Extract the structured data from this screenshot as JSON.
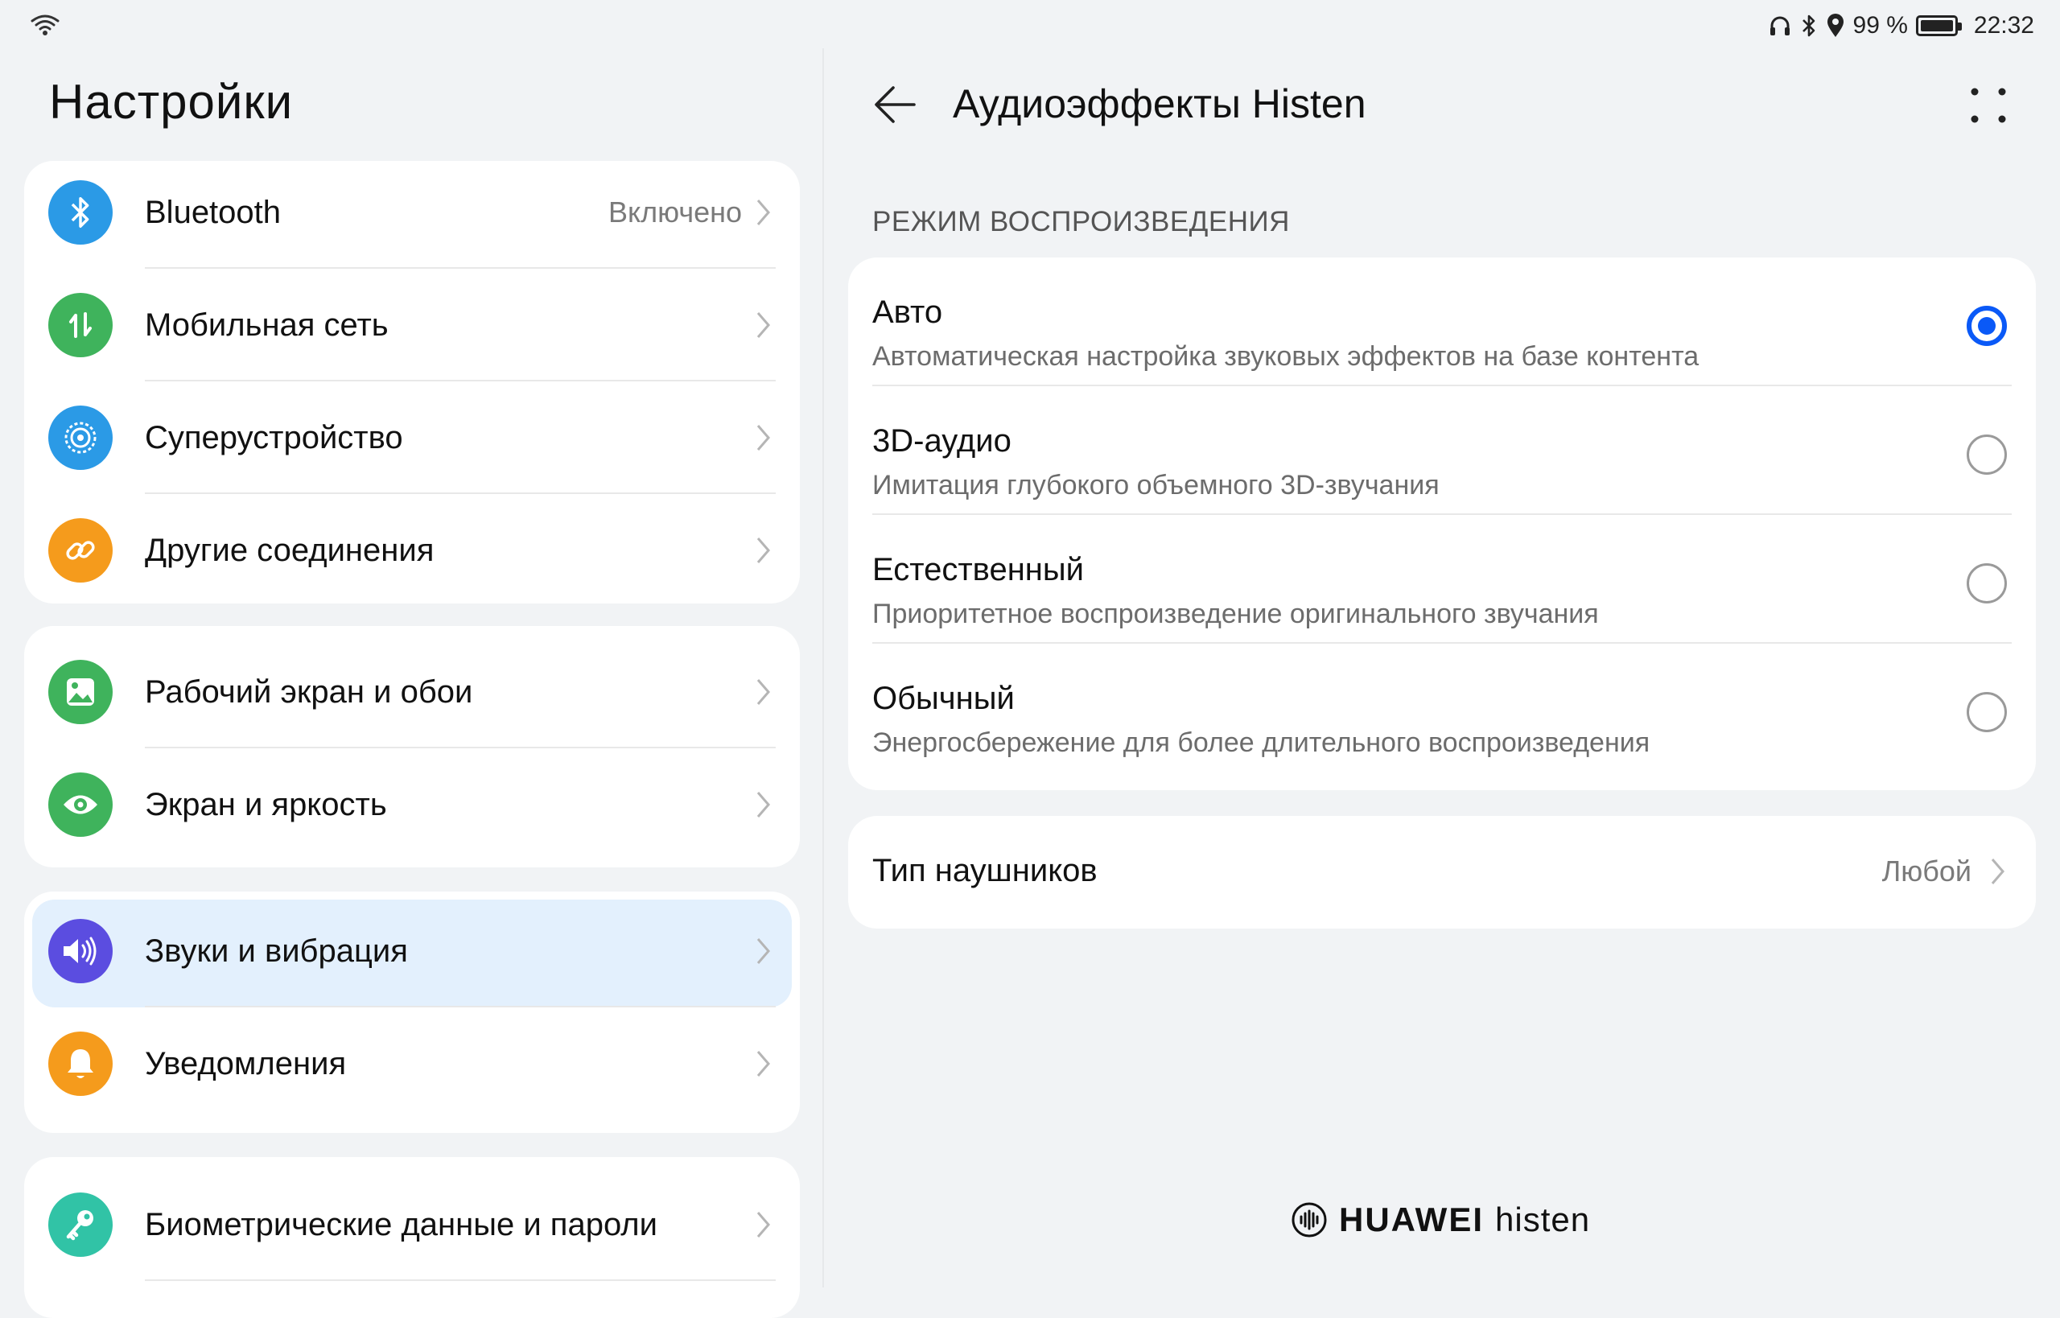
{
  "status_bar": {
    "battery_text": "99 %",
    "battery_level": 0.99,
    "time": "22:32",
    "icons": [
      "wifi-icon",
      "headphones-icon",
      "bluetooth-icon",
      "location-icon",
      "battery-icon"
    ]
  },
  "left": {
    "title": "Настройки",
    "groups": [
      {
        "items": [
          {
            "label": "Bluetooth",
            "value": "Включено",
            "icon": "bluetooth-icon",
            "color": "#2b9ae6"
          },
          {
            "label": "Мобильная сеть",
            "icon": "mobile-data-icon",
            "color": "#3fb35c"
          },
          {
            "label": "Суперустройство",
            "icon": "super-device-icon",
            "color": "#2b9ae6"
          },
          {
            "label": "Другие соединения",
            "icon": "link-icon",
            "color": "#f59b1c"
          }
        ]
      },
      {
        "items": [
          {
            "label": "Рабочий экран и обои",
            "icon": "wallpaper-icon",
            "color": "#3fb35c"
          },
          {
            "label": "Экран и яркость",
            "icon": "eye-icon",
            "color": "#3fb35c"
          }
        ]
      },
      {
        "items": [
          {
            "label": "Звуки и вибрация",
            "icon": "speaker-icon",
            "color": "#5b4de0",
            "selected": true
          },
          {
            "label": "Уведомления",
            "icon": "bell-icon",
            "color": "#f59b1c"
          }
        ]
      },
      {
        "items": [
          {
            "label": "Биометрические данные и пароли",
            "icon": "key-icon",
            "color": "#31c3a6"
          }
        ]
      }
    ]
  },
  "right": {
    "title": "Аудиоэффекты Histen",
    "section_label": "РЕЖИМ ВОСПРОИЗВЕДЕНИЯ",
    "options": [
      {
        "title": "Авто",
        "desc": "Автоматическая настройка звуковых эффектов на базе контента",
        "checked": true
      },
      {
        "title": "3D-аудио",
        "desc": "Имитация глубокого объемного 3D-звучания",
        "checked": false
      },
      {
        "title": "Естественный",
        "desc": "Приоритетное воспроизведение оригинального звучания",
        "checked": false
      },
      {
        "title": "Обычный",
        "desc": "Энергосбережение для более длительного воспроизведения",
        "checked": false
      }
    ],
    "headphone_type": {
      "label": "Тип наушников",
      "value": "Любой"
    },
    "brand": {
      "huawei": "HUAWEI",
      "histen": "histen"
    },
    "accent_color": "#0a59f7"
  }
}
